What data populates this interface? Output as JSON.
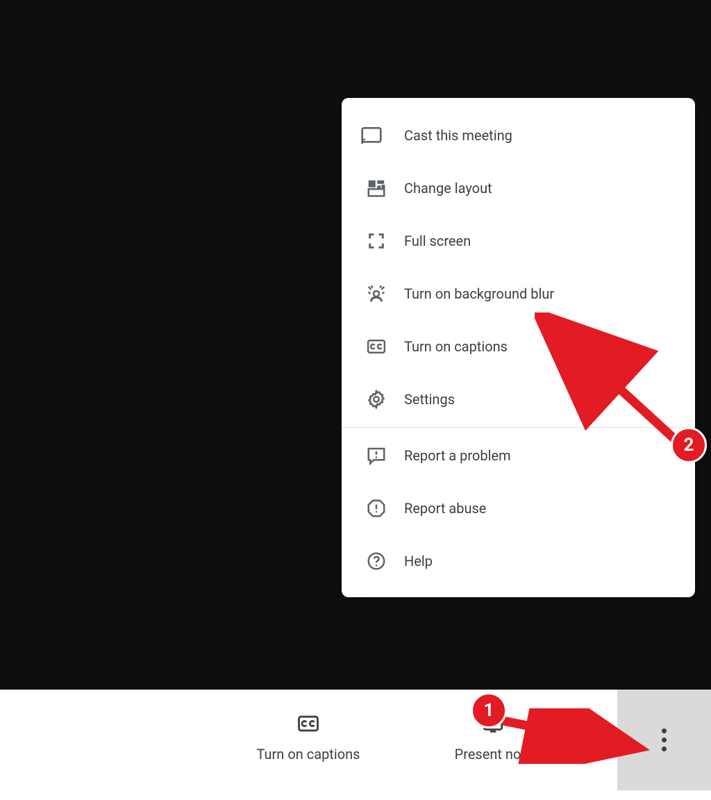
{
  "menu": {
    "items": [
      {
        "id": "cast",
        "label": "Cast this meeting"
      },
      {
        "id": "layout",
        "label": "Change layout"
      },
      {
        "id": "fullscreen",
        "label": "Full screen"
      },
      {
        "id": "blur",
        "label": "Turn on background blur"
      },
      {
        "id": "captions",
        "label": "Turn on captions"
      },
      {
        "id": "settings",
        "label": "Settings"
      },
      {
        "id": "report",
        "label": "Report a problem"
      },
      {
        "id": "abuse",
        "label": "Report abuse"
      },
      {
        "id": "help",
        "label": "Help"
      }
    ]
  },
  "toolbar": {
    "captions_label": "Turn on captions",
    "present_label": "Present now"
  },
  "annotations": {
    "step1": "1",
    "step2": "2",
    "color": "#e31b23"
  }
}
